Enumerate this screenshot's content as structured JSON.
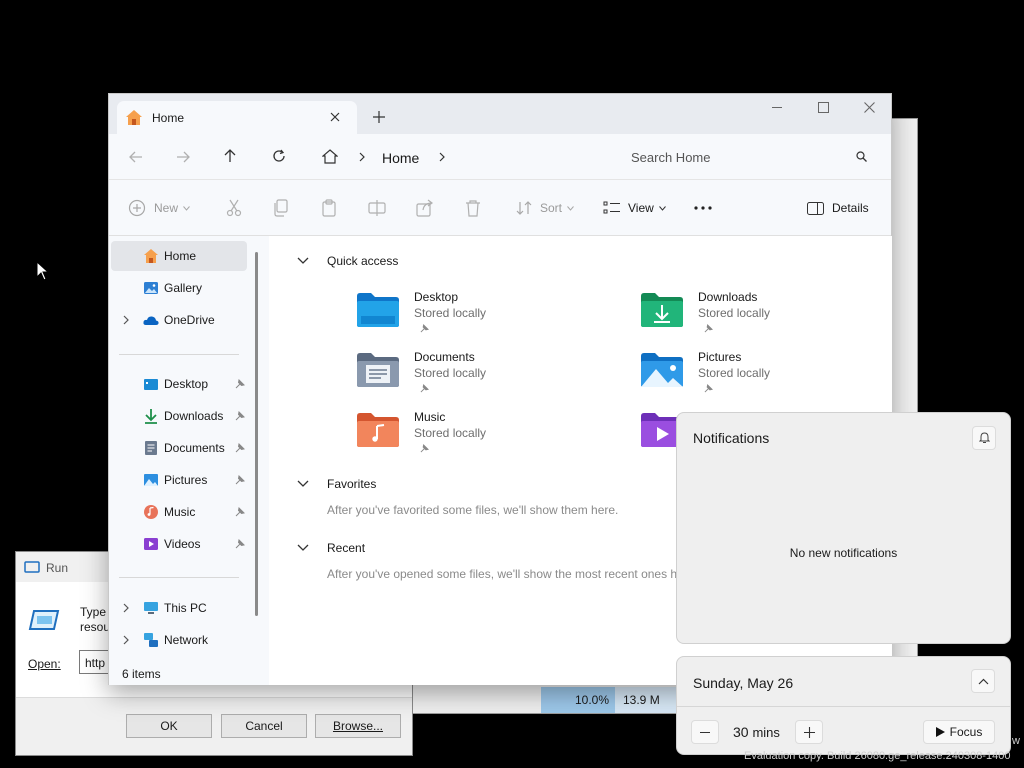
{
  "explorer": {
    "tab_title": "Home",
    "breadcrumb_current": "Home",
    "search_placeholder": "Search Home",
    "toolbar": {
      "new": "New",
      "sort": "Sort",
      "view": "View",
      "details": "Details"
    },
    "nav": {
      "home": "Home",
      "gallery": "Gallery",
      "onedrive": "OneDrive",
      "desktop": "Desktop",
      "downloads": "Downloads",
      "documents": "Documents",
      "pictures": "Pictures",
      "music": "Music",
      "videos": "Videos",
      "thispc": "This PC",
      "network": "Network"
    },
    "status": "6 items",
    "quick_access": {
      "heading": "Quick access",
      "items": [
        {
          "name": "Desktop",
          "sub": "Stored locally"
        },
        {
          "name": "Downloads",
          "sub": "Stored locally"
        },
        {
          "name": "Documents",
          "sub": "Stored locally"
        },
        {
          "name": "Pictures",
          "sub": "Stored locally"
        },
        {
          "name": "Music",
          "sub": "Stored locally"
        }
      ]
    },
    "favorites": {
      "heading": "Favorites",
      "hint": "After you've favorited some files, we'll show them here."
    },
    "recent": {
      "heading": "Recent",
      "hint": "After you've opened some files, we'll show the most recent ones h"
    }
  },
  "run": {
    "title": "Run",
    "desc1": "Type",
    "desc2": "resou",
    "open_label": "Open:",
    "open_value": "http",
    "ok": "OK",
    "cancel": "Cancel",
    "browse": "Browse..."
  },
  "bg": {
    "cell1": "10.0%",
    "cell2": "13.9 M"
  },
  "notifications": {
    "title": "Notifications",
    "empty": "No new notifications"
  },
  "calendar": {
    "date": "Sunday, May 26",
    "minutes": "30",
    "unit": "mins",
    "focus": "Focus"
  },
  "desktop": {
    "watermark1": "w",
    "watermark2": "Evaluation copy. Build 26080.ge_release.240308-1400"
  }
}
